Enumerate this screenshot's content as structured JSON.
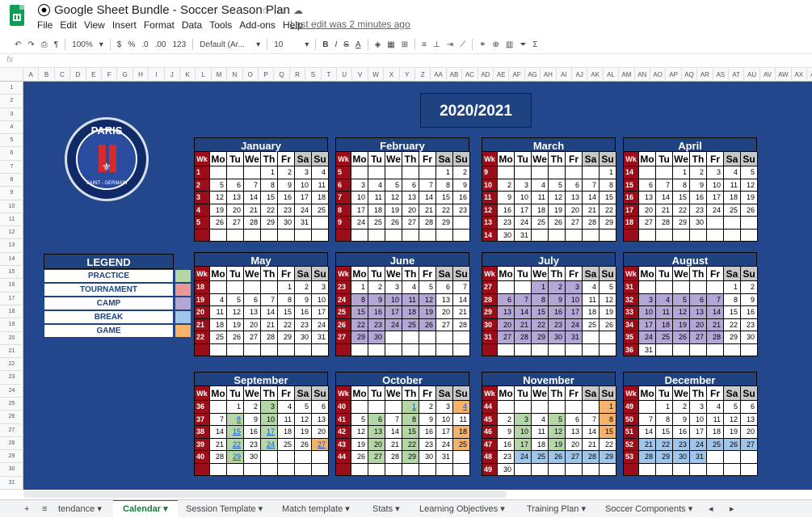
{
  "doc": {
    "title": "Google Sheet Bundle - Soccer Season Plan",
    "last_edit": "Last edit was 2 minutes ago"
  },
  "menu": [
    "File",
    "Edit",
    "View",
    "Insert",
    "Format",
    "Data",
    "Tools",
    "Add-ons",
    "Help"
  ],
  "toolbar": {
    "zoom": "100%",
    "currency": "$",
    "percent": "%",
    "dec_dec": ".0",
    "inc_dec": ".00",
    "more_formats": "123",
    "font": "Default (Ar...",
    "font_size": "10",
    "bold": "B",
    "italic": "I",
    "strike": "S",
    "text_color": "A",
    "sum": "Σ"
  },
  "formula_bar": {
    "fx": "fx"
  },
  "columns": [
    "A",
    "B",
    "C",
    "D",
    "E",
    "F",
    "G",
    "H",
    "I",
    "J",
    "K",
    "L",
    "M",
    "N",
    "O",
    "P",
    "Q",
    "R",
    "S",
    "T",
    "U",
    "V",
    "W",
    "X",
    "Y",
    "Z",
    "AA",
    "AB",
    "AC",
    "AD",
    "AE",
    "AF",
    "AG",
    "AH",
    "AI",
    "AJ",
    "AK",
    "AL",
    "AM",
    "AN",
    "AO",
    "AP",
    "AQ",
    "AR",
    "AS",
    "AT",
    "AU",
    "AV",
    "AW",
    "AX",
    "AY"
  ],
  "rows": [
    "1",
    "2",
    "3",
    "4",
    "5",
    "6",
    "7",
    "8",
    "9",
    "10",
    "11",
    "12",
    "13",
    "14",
    "15",
    "16",
    "17",
    "18",
    "19",
    "20",
    "21",
    "22",
    "23",
    "24",
    "25",
    "26",
    "27",
    "28",
    "29",
    "30",
    "31"
  ],
  "year_title": "2020/2021",
  "crest": {
    "top": "PARIS",
    "bottom": "SAINT - GERMAIN"
  },
  "legend": {
    "title": "LEGEND",
    "items": [
      {
        "label": "PRACTICE",
        "color": "#b5d7a8"
      },
      {
        "label": "TOURNAMENT",
        "color": "#e99895"
      },
      {
        "label": "CAMP",
        "color": "#b4a7d6"
      },
      {
        "label": "BREAK",
        "color": "#9fc5e8"
      },
      {
        "label": "GAME",
        "color": "#f5b26b"
      }
    ]
  },
  "weekday_headers": [
    "Wk",
    "Mo",
    "Tu",
    "We",
    "Th",
    "Fr",
    "Sa",
    "Su"
  ],
  "months": [
    {
      "name": "January",
      "weeks": [
        [
          "1",
          "",
          "",
          "",
          "1",
          "2",
          "3",
          "4"
        ],
        [
          "2",
          "5",
          "6",
          "7",
          "8",
          "9",
          "10",
          "11"
        ],
        [
          "3",
          "12",
          "13",
          "14",
          "15",
          "16",
          "17",
          "18"
        ],
        [
          "4",
          "19",
          "20",
          "21",
          "22",
          "23",
          "24",
          "25"
        ],
        [
          "5",
          "26",
          "27",
          "28",
          "29",
          "30",
          "31",
          ""
        ],
        [
          "",
          "",
          "",
          "",
          "",
          "",
          "",
          ""
        ]
      ]
    },
    {
      "name": "February",
      "weeks": [
        [
          "5",
          "",
          "",
          "",
          "",
          "",
          "1",
          "2"
        ],
        [
          "6",
          "3",
          "4",
          "5",
          "6",
          "7",
          "8",
          "9"
        ],
        [
          "7",
          "10",
          "11",
          "12",
          "13",
          "14",
          "15",
          "16"
        ],
        [
          "8",
          "17",
          "18",
          "19",
          "20",
          "21",
          "22",
          "23"
        ],
        [
          "9",
          "24",
          "25",
          "26",
          "27",
          "28",
          "29",
          ""
        ],
        [
          "",
          "",
          "",
          "",
          "",
          "",
          "",
          ""
        ]
      ]
    },
    {
      "name": "March",
      "weeks": [
        [
          "9",
          "",
          "",
          "",
          "",
          "",
          "",
          "1"
        ],
        [
          "10",
          "2",
          "3",
          "4",
          "5",
          "6",
          "7",
          "8"
        ],
        [
          "11",
          "9",
          "10",
          "11",
          "12",
          "13",
          "14",
          "15"
        ],
        [
          "12",
          "16",
          "17",
          "18",
          "19",
          "20",
          "21",
          "22"
        ],
        [
          "13",
          "23",
          "24",
          "25",
          "26",
          "27",
          "28",
          "29"
        ],
        [
          "14",
          "30",
          "31",
          "",
          "",
          "",
          "",
          ""
        ]
      ]
    },
    {
      "name": "April",
      "weeks": [
        [
          "14",
          "",
          "",
          "1",
          "2",
          "3",
          "4",
          "5"
        ],
        [
          "15",
          "6",
          "7",
          "8",
          "9",
          "10",
          "11",
          "12"
        ],
        [
          "16",
          "13",
          "14",
          "15",
          "16",
          "17",
          "18",
          "19"
        ],
        [
          "17",
          "20",
          "21",
          "22",
          "23",
          "24",
          "25",
          "26"
        ],
        [
          "18",
          "27",
          "28",
          "29",
          "30",
          "",
          "",
          ""
        ],
        [
          "",
          "",
          "",
          "",
          "",
          "",
          "",
          ""
        ]
      ]
    },
    {
      "name": "May",
      "weeks": [
        [
          "18",
          "",
          "",
          "",
          "",
          "1",
          "2",
          "3"
        ],
        [
          "19",
          "4",
          "5",
          "6",
          "7",
          "8",
          "9",
          "10"
        ],
        [
          "20",
          "11",
          "12",
          "13",
          "14",
          "15",
          "16",
          "17"
        ],
        [
          "21",
          "18",
          "19",
          "20",
          "21",
          "22",
          "23",
          "24"
        ],
        [
          "22",
          "25",
          "26",
          "27",
          "28",
          "29",
          "30",
          "31"
        ],
        [
          "",
          "",
          "",
          "",
          "",
          "",
          "",
          ""
        ]
      ]
    },
    {
      "name": "June",
      "weeks": [
        [
          "23",
          "1",
          "2",
          "3",
          "4",
          "5",
          "6",
          "7"
        ],
        [
          "24",
          "8",
          "9",
          "10",
          "11",
          "12",
          "13",
          "14"
        ],
        [
          "25",
          "15",
          "16",
          "17",
          "18",
          "19",
          "20",
          "21"
        ],
        [
          "26",
          "22",
          "23",
          "24",
          "25",
          "26",
          "27",
          "28"
        ],
        [
          "27",
          "29",
          "30",
          "",
          "",
          "",
          "",
          ""
        ],
        [
          "",
          "",
          "",
          "",
          "",
          "",
          "",
          ""
        ]
      ]
    },
    {
      "name": "July",
      "weeks": [
        [
          "27",
          "",
          "",
          "1",
          "2",
          "3",
          "4",
          "5"
        ],
        [
          "28",
          "6",
          "7",
          "8",
          "9",
          "10",
          "11",
          "12"
        ],
        [
          "29",
          "13",
          "14",
          "15",
          "16",
          "17",
          "18",
          "19"
        ],
        [
          "30",
          "20",
          "21",
          "22",
          "23",
          "24",
          "25",
          "26"
        ],
        [
          "31",
          "27",
          "28",
          "29",
          "30",
          "31",
          "",
          ""
        ],
        [
          "",
          "",
          "",
          "",
          "",
          "",
          "",
          ""
        ]
      ]
    },
    {
      "name": "August",
      "weeks": [
        [
          "31",
          "",
          "",
          "",
          "",
          "",
          "1",
          "2"
        ],
        [
          "32",
          "3",
          "4",
          "5",
          "6",
          "7",
          "8",
          "9"
        ],
        [
          "33",
          "10",
          "11",
          "12",
          "13",
          "14",
          "15",
          "16"
        ],
        [
          "34",
          "17",
          "18",
          "19",
          "20",
          "21",
          "22",
          "23"
        ],
        [
          "35",
          "24",
          "25",
          "26",
          "27",
          "28",
          "29",
          "30"
        ],
        [
          "36",
          "31",
          "",
          "",
          "",
          "",
          "",
          ""
        ]
      ]
    },
    {
      "name": "September",
      "weeks": [
        [
          "36",
          "",
          "1",
          "2",
          "3",
          "4",
          "5",
          "6"
        ],
        [
          "37",
          "7",
          "8",
          "9",
          "10",
          "11",
          "12",
          "13"
        ],
        [
          "38",
          "14",
          "15",
          "16",
          "17",
          "18",
          "19",
          "20"
        ],
        [
          "39",
          "21",
          "22",
          "23",
          "24",
          "25",
          "26",
          "27"
        ],
        [
          "40",
          "28",
          "29",
          "30",
          "",
          "",
          "",
          ""
        ],
        [
          "",
          "",
          "",
          "",
          "",
          "",
          "",
          ""
        ]
      ]
    },
    {
      "name": "October",
      "weeks": [
        [
          "40",
          "",
          "",
          "",
          "1",
          "2",
          "3",
          "4"
        ],
        [
          "41",
          "5",
          "6",
          "7",
          "8",
          "9",
          "10",
          "11"
        ],
        [
          "42",
          "12",
          "13",
          "14",
          "15",
          "16",
          "17",
          "18"
        ],
        [
          "43",
          "19",
          "20",
          "21",
          "22",
          "23",
          "24",
          "25"
        ],
        [
          "44",
          "26",
          "27",
          "28",
          "29",
          "30",
          "31",
          ""
        ],
        [
          "",
          "",
          "",
          "",
          "",
          "",
          "",
          ""
        ]
      ]
    },
    {
      "name": "November",
      "weeks": [
        [
          "44",
          "",
          "",
          "",
          "",
          "",
          "",
          "1"
        ],
        [
          "45",
          "2",
          "3",
          "4",
          "5",
          "6",
          "7",
          "8"
        ],
        [
          "46",
          "9",
          "10",
          "11",
          "12",
          "13",
          "14",
          "15"
        ],
        [
          "47",
          "16",
          "17",
          "18",
          "19",
          "20",
          "21",
          "22"
        ],
        [
          "48",
          "23",
          "24",
          "25",
          "26",
          "27",
          "28",
          "29"
        ],
        [
          "49",
          "30",
          "",
          "",
          "",
          "",
          "",
          ""
        ]
      ]
    },
    {
      "name": "December",
      "weeks": [
        [
          "49",
          "",
          "1",
          "2",
          "3",
          "4",
          "5",
          "6"
        ],
        [
          "50",
          "7",
          "8",
          "9",
          "10",
          "11",
          "12",
          "13"
        ],
        [
          "51",
          "14",
          "15",
          "16",
          "17",
          "18",
          "19",
          "20"
        ],
        [
          "52",
          "21",
          "22",
          "23",
          "24",
          "25",
          "26",
          "27"
        ],
        [
          "53",
          "28",
          "29",
          "30",
          "31",
          "",
          "",
          ""
        ],
        [
          "",
          "",
          "",
          "",
          "",
          "",
          "",
          ""
        ]
      ]
    }
  ],
  "highlights": {
    "June": {
      "camp": [
        [
          1,
          1
        ],
        [
          1,
          2
        ],
        [
          1,
          3
        ],
        [
          1,
          4
        ],
        [
          1,
          5
        ],
        [
          2,
          1
        ],
        [
          2,
          2
        ],
        [
          2,
          3
        ],
        [
          2,
          4
        ],
        [
          2,
          5
        ],
        [
          3,
          1
        ],
        [
          3,
          2
        ],
        [
          3,
          3
        ],
        [
          3,
          4
        ],
        [
          3,
          5
        ],
        [
          4,
          1
        ],
        [
          4,
          2
        ]
      ]
    },
    "July": {
      "camp": [
        [
          0,
          3
        ],
        [
          0,
          4
        ],
        [
          0,
          5
        ],
        [
          1,
          1
        ],
        [
          1,
          2
        ],
        [
          1,
          3
        ],
        [
          1,
          4
        ],
        [
          1,
          5
        ],
        [
          2,
          1
        ],
        [
          2,
          2
        ],
        [
          2,
          3
        ],
        [
          2,
          4
        ],
        [
          2,
          5
        ],
        [
          3,
          1
        ],
        [
          3,
          2
        ],
        [
          3,
          3
        ],
        [
          3,
          4
        ],
        [
          3,
          5
        ],
        [
          4,
          1
        ],
        [
          4,
          2
        ],
        [
          4,
          3
        ],
        [
          4,
          4
        ],
        [
          4,
          5
        ]
      ]
    },
    "August": {
      "camp": [
        [
          1,
          1
        ],
        [
          1,
          2
        ],
        [
          1,
          3
        ],
        [
          1,
          4
        ],
        [
          1,
          5
        ],
        [
          2,
          1
        ],
        [
          2,
          2
        ],
        [
          2,
          3
        ],
        [
          2,
          4
        ],
        [
          2,
          5
        ],
        [
          3,
          1
        ],
        [
          3,
          2
        ],
        [
          3,
          3
        ],
        [
          3,
          4
        ],
        [
          3,
          5
        ],
        [
          4,
          1
        ],
        [
          4,
          2
        ],
        [
          4,
          3
        ],
        [
          4,
          4
        ],
        [
          4,
          5
        ]
      ]
    },
    "September": {
      "practice": [
        [
          0,
          4
        ],
        [
          1,
          2
        ],
        [
          1,
          4
        ],
        [
          2,
          2
        ],
        [
          2,
          4
        ],
        [
          3,
          2
        ],
        [
          3,
          4
        ],
        [
          4,
          2
        ]
      ],
      "game": [
        [
          3,
          7
        ]
      ]
    },
    "October": {
      "practice": [
        [
          0,
          4
        ],
        [
          1,
          2
        ],
        [
          1,
          4
        ],
        [
          2,
          2
        ],
        [
          2,
          4
        ],
        [
          3,
          2
        ],
        [
          3,
          4
        ],
        [
          4,
          2
        ],
        [
          4,
          4
        ]
      ],
      "game": [
        [
          0,
          7
        ],
        [
          2,
          7
        ],
        [
          3,
          7
        ]
      ]
    },
    "November": {
      "practice": [
        [
          1,
          2
        ],
        [
          1,
          4
        ],
        [
          2,
          2
        ],
        [
          2,
          4
        ],
        [
          3,
          2
        ],
        [
          3,
          4
        ]
      ],
      "game": [
        [
          0,
          7
        ],
        [
          1,
          7
        ],
        [
          2,
          7
        ]
      ],
      "break": [
        [
          4,
          2
        ],
        [
          4,
          3
        ],
        [
          4,
          4
        ],
        [
          4,
          5
        ],
        [
          4,
          6
        ],
        [
          4,
          7
        ]
      ]
    },
    "December": {
      "break": [
        [
          3,
          1
        ],
        [
          3,
          2
        ],
        [
          3,
          3
        ],
        [
          3,
          4
        ],
        [
          3,
          5
        ],
        [
          3,
          6
        ],
        [
          3,
          7
        ],
        [
          4,
          1
        ],
        [
          4,
          2
        ],
        [
          4,
          3
        ],
        [
          4,
          4
        ]
      ]
    }
  },
  "tabs": [
    "tendance",
    "Calendar",
    "Session Template",
    "Match template",
    "Stats",
    "Learning Objectives",
    "Training Plan",
    "Soccer Components"
  ],
  "active_tab": "Calendar"
}
